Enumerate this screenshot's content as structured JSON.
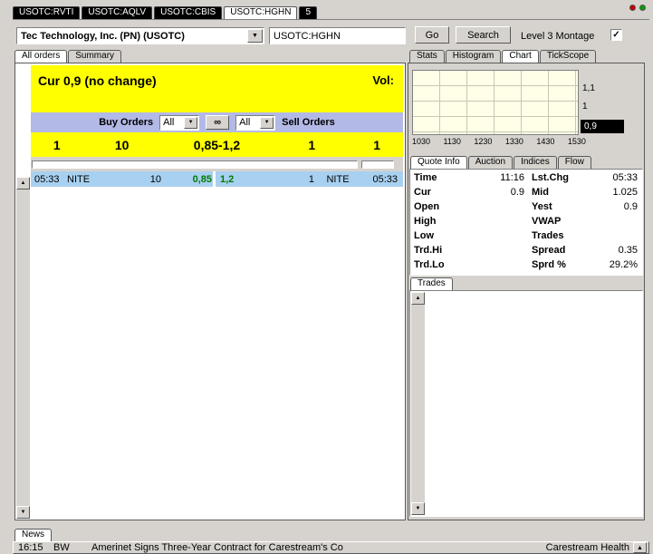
{
  "window": {
    "tabs": [
      {
        "label": "USOTC:RVTI"
      },
      {
        "label": "USOTC:AQLV"
      },
      {
        "label": "USOTC:CBIS"
      },
      {
        "label": "USOTC:HGHN"
      },
      {
        "label": "5"
      }
    ]
  },
  "icons": {
    "dropdown": "▼",
    "check": "✓",
    "up": "▲",
    "down": "▼",
    "link": "∞"
  },
  "toolbar": {
    "company_select": "Tec Technology, Inc. (PN) (USOTC)",
    "symbol_input": "USOTC:HGHN",
    "go": "Go",
    "search": "Search",
    "level3_label": "Level 3 Montage"
  },
  "montage": {
    "tabs": {
      "all_orders": "All orders",
      "summary": "Summary"
    },
    "cur_line": "Cur 0,9 (no change)",
    "vol_label": "Vol:",
    "buy_label": "Buy Orders",
    "buy_filter": "All",
    "sell_filter": "All",
    "sell_label": "Sell Orders",
    "totals": {
      "buy_count": "1",
      "buy_size": "10",
      "range": "0,85-1,2",
      "sell_size": "1",
      "sell_count": "1"
    },
    "order": {
      "bid_time": "05:33",
      "bid_mmid": "NITE",
      "bid_size": "10",
      "bid_price": "0,85",
      "ask_price": "1,2",
      "ask_size": "1",
      "ask_mmid": "NITE",
      "ask_time": "05:33"
    }
  },
  "right": {
    "tabs": {
      "stats": "Stats",
      "histogram": "Histogram",
      "chart": "Chart",
      "tickscope": "TickScope"
    },
    "quote_tabs": {
      "quote_info": "Quote Info",
      "auction": "Auction",
      "indices": "Indices",
      "flow": "Flow"
    },
    "quote": {
      "rows": [
        {
          "l1": "Time",
          "v1": "11:16",
          "l2": "Lst.Chg",
          "v2": "05:33"
        },
        {
          "l1": "Cur",
          "v1": "0.9",
          "l2": "Mid",
          "v2": "1.025"
        },
        {
          "l1": "Open",
          "v1": "",
          "l2": "Yest",
          "v2": "0.9"
        },
        {
          "l1": "High",
          "v1": "",
          "l2": "VWAP",
          "v2": ""
        },
        {
          "l1": "Low",
          "v1": "",
          "l2": "Trades",
          "v2": ""
        },
        {
          "l1": "Trd.Hi",
          "v1": "",
          "l2": "Spread",
          "v2": "0.35"
        },
        {
          "l1": "Trd.Lo",
          "v1": "",
          "l2": "Sprd %",
          "v2": "29.2%"
        }
      ]
    },
    "trades_tab": "Trades"
  },
  "news": {
    "tab": "News",
    "time": "16:15",
    "source": "BW",
    "headline": "Amerinet Signs Three-Year Contract for Carestream's Co",
    "ticker_right": "Carestream Health"
  },
  "chart_data": {
    "type": "line",
    "title": "",
    "x_ticks": [
      "1030",
      "1130",
      "1230",
      "1330",
      "1430",
      "1530"
    ],
    "y_axis_labels": [
      "1,1",
      "1",
      "0,9"
    ],
    "last_price_label": "0,9",
    "series": [],
    "grid": true,
    "legend": false
  },
  "colors": {
    "accent_yellow": "#ffff00",
    "filter_band_blue": "#b3b9e6",
    "row_highlight_blue": "#a8d0f0",
    "price_green": "#007a00",
    "chart_bg": "#ffffe8",
    "marker_bg": "#000000"
  }
}
